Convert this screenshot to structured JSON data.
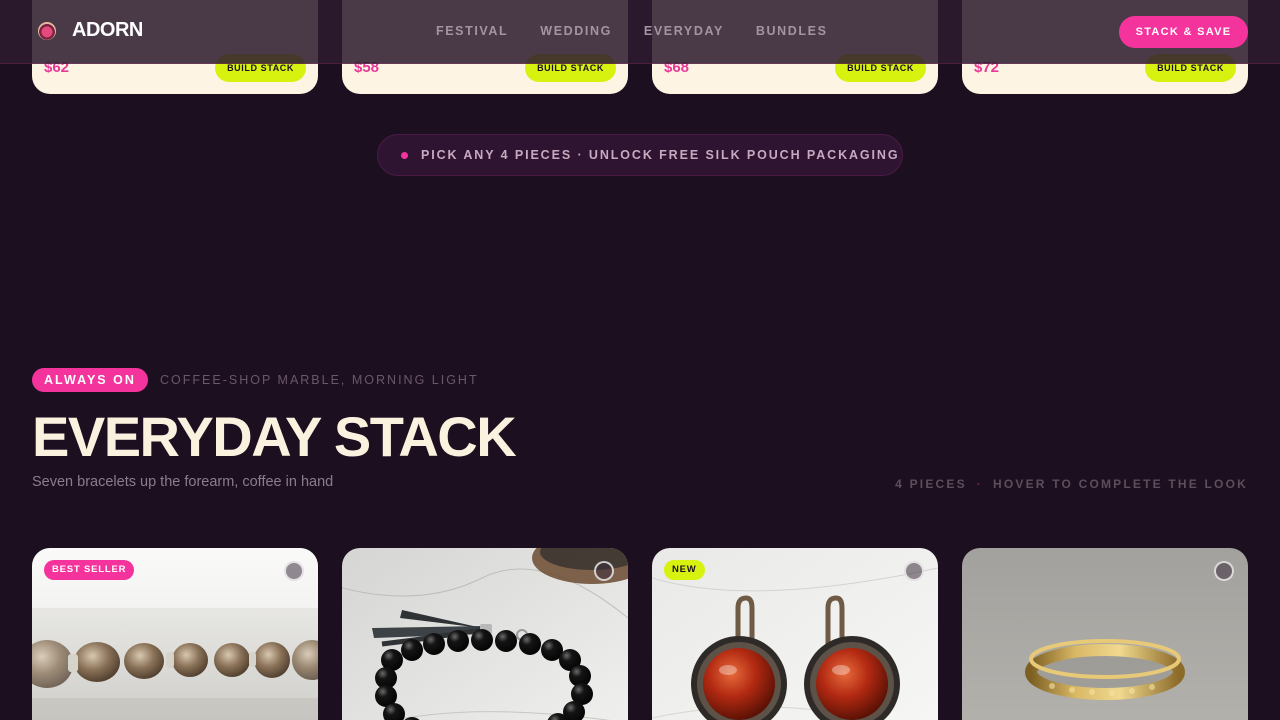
{
  "header": {
    "brand": "ADORN",
    "nav": [
      "FESTIVAL",
      "WEDDING",
      "EVERYDAY",
      "BUNDLES"
    ],
    "cta": "STACK & SAVE"
  },
  "top_cards": [
    {
      "price": "$62",
      "button": "BUILD STACK"
    },
    {
      "price": "$58",
      "button": "BUILD STACK"
    },
    {
      "price": "$68",
      "button": "BUILD STACK"
    },
    {
      "price": "$72",
      "button": "BUILD STACK"
    }
  ],
  "promo": {
    "text": "PICK ANY 4 PIECES · UNLOCK FREE SILK POUCH PACKAGING"
  },
  "section": {
    "tag": "ALWAYS ON",
    "tag_sub": "COFFEE-SHOP MARBLE, MORNING LIGHT",
    "title": "EVERYDAY STACK",
    "description": "Seven bracelets up the forearm, coffee in hand",
    "meta_count": "4 PIECES",
    "meta_hint": "HOVER TO COMPLETE THE LOOK"
  },
  "products": [
    {
      "badge": "BEST SELLER"
    },
    {
      "badge": ""
    },
    {
      "badge": "NEW"
    },
    {
      "badge": ""
    }
  ],
  "colors": {
    "background": "#1c0f1f",
    "accent_pink": "#f5339c",
    "accent_lime": "#d7f20f",
    "cream": "#fdf4e3"
  },
  "icons": {
    "logo": "brand-gem-icon",
    "favorite": "favorite-circle-icon",
    "promo": "dot-icon"
  }
}
